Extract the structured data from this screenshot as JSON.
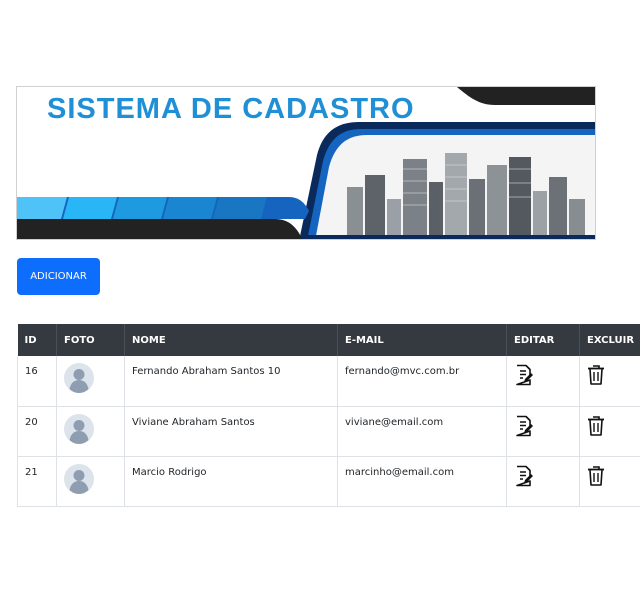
{
  "banner": {
    "title": "SISTEMA DE CADASTRO",
    "colors": {
      "title": "#1f8fd6",
      "navy": "#0b2a5c",
      "blue": "#1565c0",
      "light_blue": "#29b6f6",
      "dark": "#222222"
    }
  },
  "toolbar": {
    "add_label": "ADICIONAR",
    "add_color": "#0d6efd"
  },
  "table": {
    "headers": {
      "id": "ID",
      "foto": "FOTO",
      "nome": "NOME",
      "email": "E-MAIL",
      "editar": "EDITAR",
      "excluir": "EXCLUIR"
    },
    "header_bg": "#343a40",
    "rows": [
      {
        "id": "16",
        "nome": "Fernando Abraham Santos 10",
        "email": "fernando@mvc.com.br",
        "foto_icon": "avatar-placeholder-icon",
        "edit_icon": "edit-document-icon",
        "delete_icon": "trash-icon"
      },
      {
        "id": "20",
        "nome": "Viviane Abraham Santos",
        "email": "viviane@email.com",
        "foto_icon": "avatar-placeholder-icon",
        "edit_icon": "edit-document-icon",
        "delete_icon": "trash-icon"
      },
      {
        "id": "21",
        "nome": "Marcio Rodrigo",
        "email": "marcinho@email.com",
        "foto_icon": "avatar-placeholder-icon",
        "edit_icon": "edit-document-icon",
        "delete_icon": "trash-icon"
      }
    ]
  }
}
